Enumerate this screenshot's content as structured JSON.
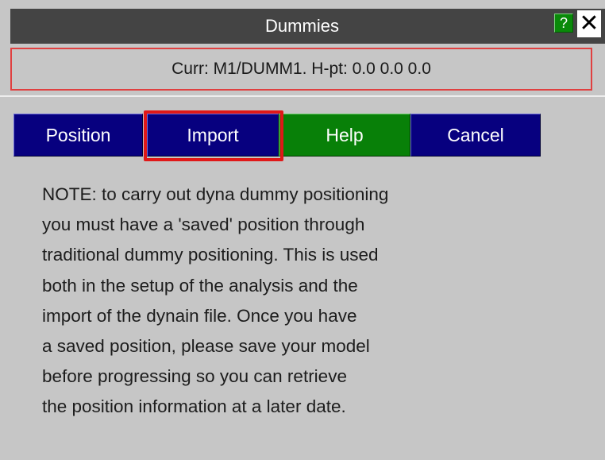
{
  "window": {
    "title": "Dummies",
    "help_glyph": "?",
    "close_glyph": "✕"
  },
  "status": {
    "text": "Curr: M1/DUMM1. H-pt: 0.0  0.0  0.0"
  },
  "buttons": {
    "position_label": "Position",
    "import_label": "Import",
    "help_label": "Help",
    "cancel_label": "Cancel"
  },
  "note": {
    "lines": [
      "NOTE: to carry out dyna dummy positioning",
      "you must have a 'saved' position through",
      "traditional dummy positioning. This is used",
      "both in the setup of the analysis and the",
      "import of the dynain file. Once you have",
      "a saved position, please save your model",
      "before progressing so you can retrieve",
      "the position information at a later date."
    ]
  },
  "icons": {
    "help": "help-icon",
    "close": "close-icon"
  },
  "colors": {
    "background": "#c6c6c6",
    "titlebar": "#444444",
    "button_blue": "#07007f",
    "button_green": "#088008",
    "highlight_red": "#e01818",
    "status_border": "#e04040"
  }
}
